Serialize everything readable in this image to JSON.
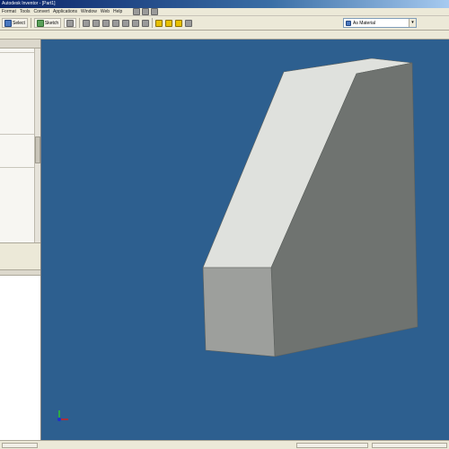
{
  "window": {
    "title": "Autodesk Inventor - [Part1]"
  },
  "menubar": {
    "items": [
      "Format",
      "Tools",
      "Convert",
      "Applications",
      "Window",
      "Web",
      "Help"
    ]
  },
  "toolbar": {
    "select_label": "Select",
    "sketch_label": "Sketch",
    "material_value": "As Material"
  },
  "colors": {
    "viewport_background": "#2d5f8f",
    "part_top_face": "#dfe1dd",
    "part_front_face": "#9d9f9c",
    "part_side_face": "#6f7370"
  },
  "viewport": {
    "axis_indicator": "xyz-triad"
  }
}
